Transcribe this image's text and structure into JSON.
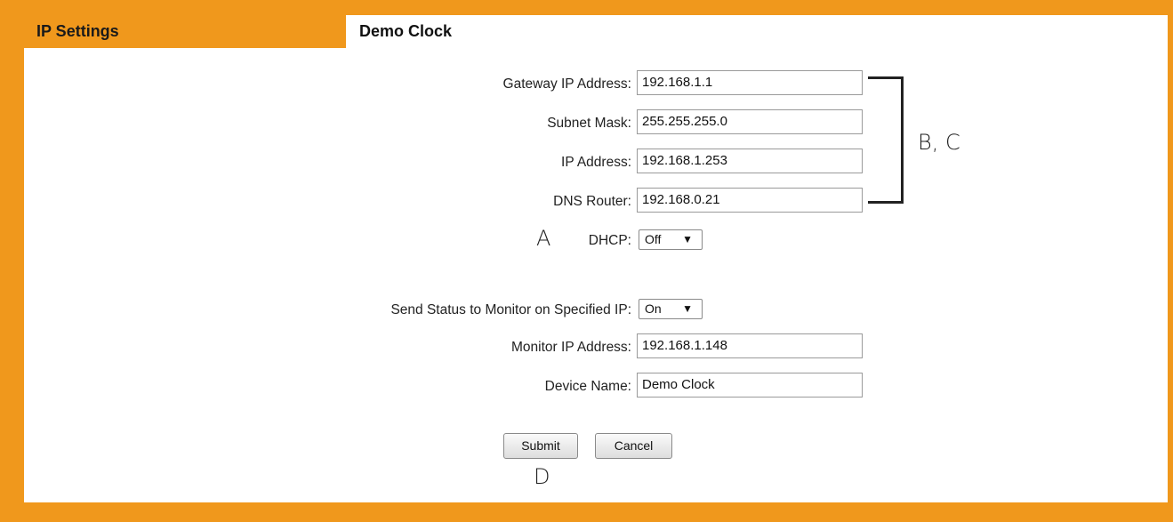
{
  "header": {
    "tab_title": "IP Settings",
    "device_title": "Demo Clock"
  },
  "form": {
    "gateway": {
      "label": "Gateway IP Address:",
      "value": "192.168.1.1"
    },
    "subnet": {
      "label": "Subnet Mask:",
      "value": "255.255.255.0"
    },
    "ip": {
      "label": "IP Address:",
      "value": "192.168.1.253"
    },
    "dns": {
      "label": "DNS Router:",
      "value": "192.168.0.21"
    },
    "dhcp": {
      "label": "DHCP:",
      "selected": "Off"
    },
    "send_status": {
      "label": "Send Status to Monitor on Specified IP:",
      "selected": "On"
    },
    "monitor_ip": {
      "label": "Monitor IP Address:",
      "value": "192.168.1.148"
    },
    "device_name": {
      "label": "Device Name:",
      "value": "Demo Clock"
    }
  },
  "buttons": {
    "submit": "Submit",
    "cancel": "Cancel"
  },
  "annotations": {
    "a": "A",
    "bc": "B, C",
    "d": "D"
  },
  "colors": {
    "background": "#f0981c",
    "panel": "#ffffff"
  },
  "icons": {
    "dropdown": "triangle-down-icon"
  }
}
